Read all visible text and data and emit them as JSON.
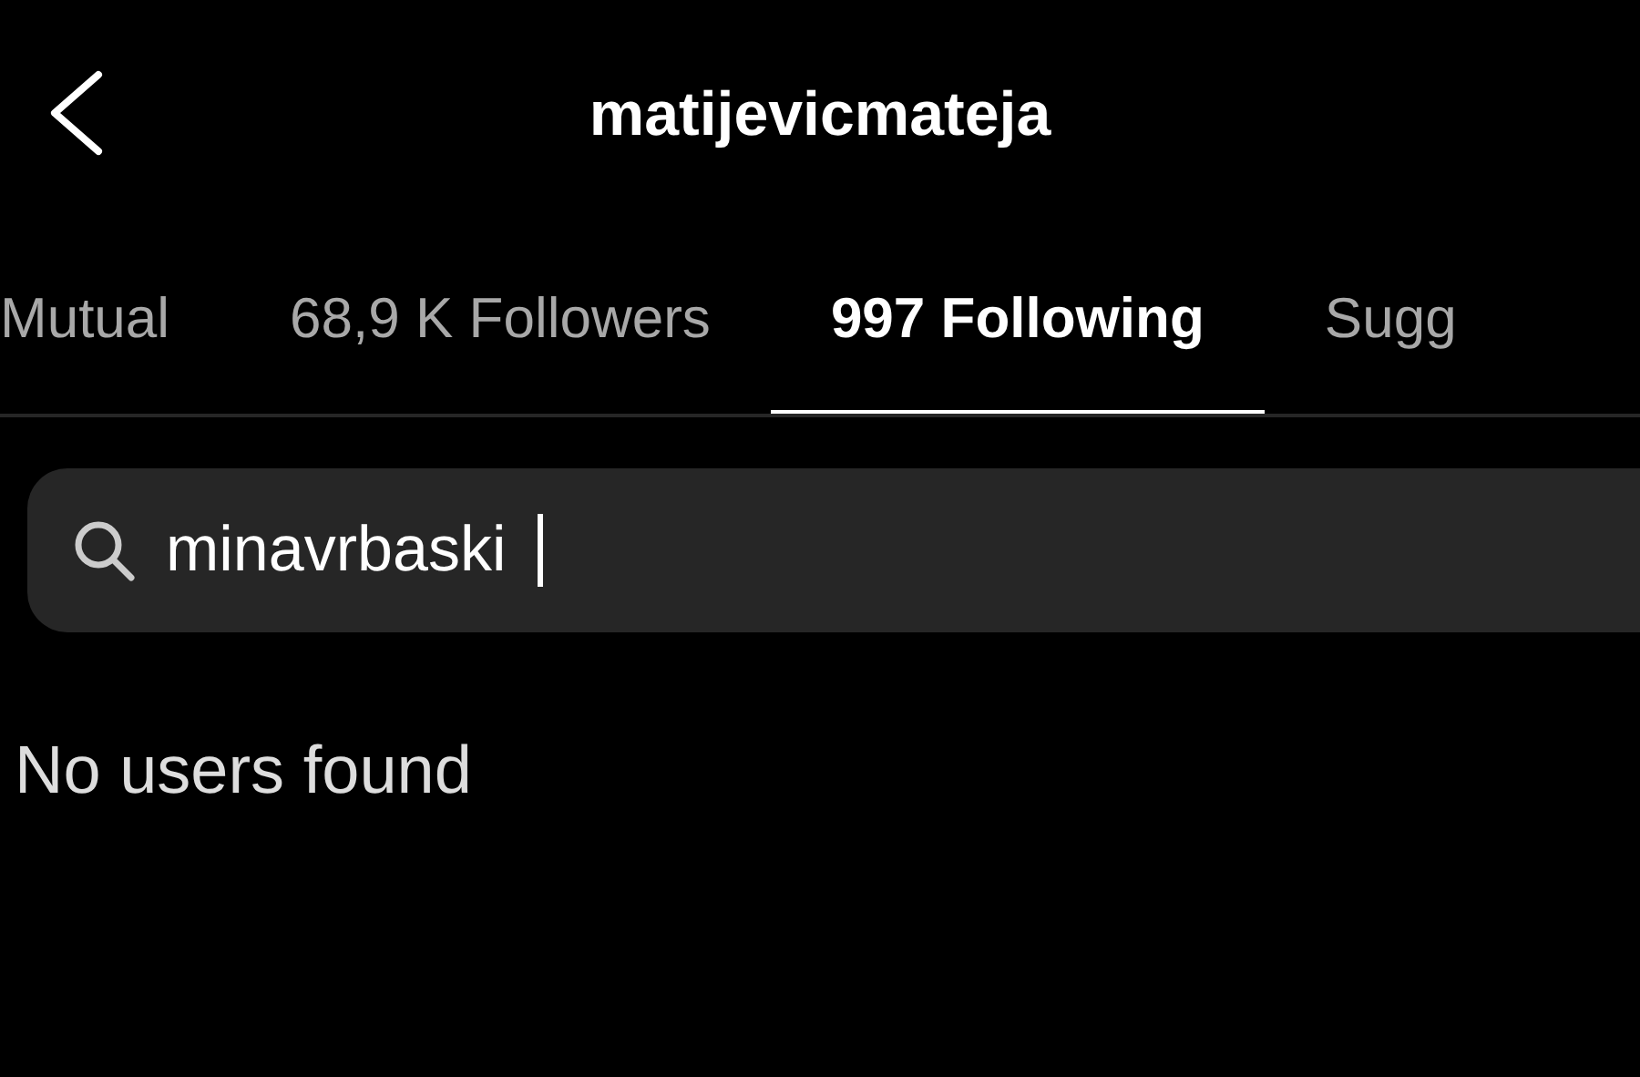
{
  "header": {
    "title": "matijevicmateja"
  },
  "tabs": [
    {
      "label": "Mutual",
      "selected": false
    },
    {
      "label": "68,9 K Followers",
      "selected": false
    },
    {
      "label": "997 Following",
      "selected": true
    },
    {
      "label": "Sugg",
      "selected": false
    }
  ],
  "search": {
    "value": "minavrbaski"
  },
  "message": "No users found"
}
